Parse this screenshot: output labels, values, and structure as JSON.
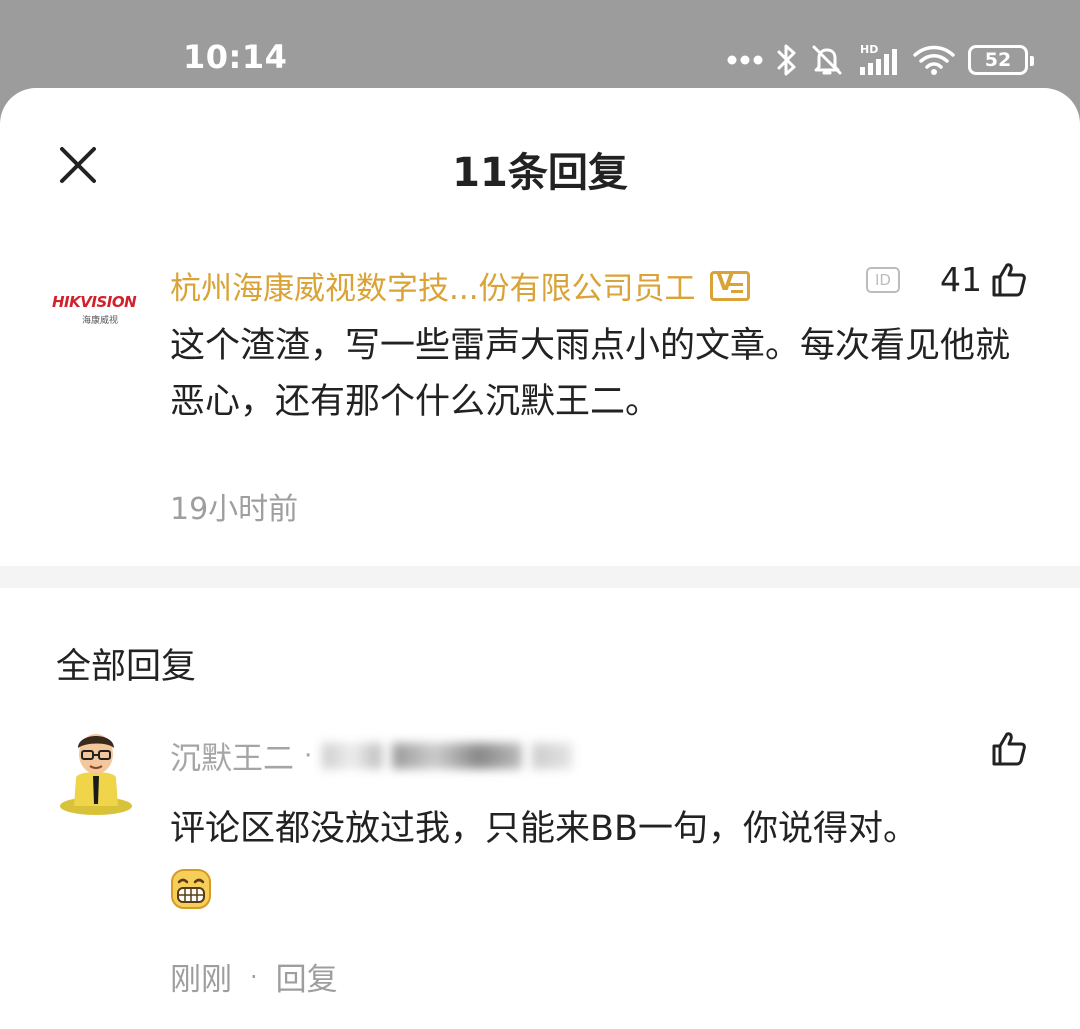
{
  "status_bar": {
    "time": "10:14",
    "battery": "52",
    "network_label": "HD"
  },
  "sheet": {
    "title": "11条回复"
  },
  "main_comment": {
    "author": "杭州海康威视数字技...份有限公司员工",
    "badge_v": "V",
    "badge_id": "ID",
    "logo_text": "HIKVISION",
    "logo_subtext": "海康威视",
    "likes": "41",
    "text": "这个渣渣，写一些雷声大雨点小的文章。每次看见他就恶心，还有那个什么沉默王二。",
    "time": "19小时前"
  },
  "section": {
    "title": "全部回复"
  },
  "reply": {
    "author": "沉默王二",
    "separator": "·",
    "text": "评论区都没放过我，只能来BB一句，你说得对。",
    "emoji": "grin-emoji",
    "time": "刚刚",
    "dot": "·",
    "reply_label": "回复"
  },
  "colors": {
    "accent_gold": "#d9a338",
    "muted_text": "#9e9e9e",
    "primary_text": "#222222",
    "logo_red": "#d0222c"
  }
}
